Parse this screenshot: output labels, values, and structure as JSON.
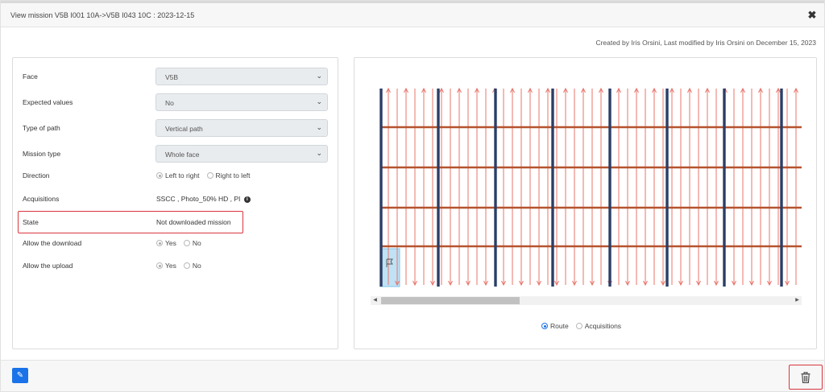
{
  "modal": {
    "title": "View mission V5B I001 10A->V5B I043 10C : 2023-12-15",
    "close_icon": "close-icon",
    "meta": "Created by Iris Orsini, Last modified by Iris Orsini on December 15, 2023"
  },
  "form": {
    "face": {
      "label": "Face",
      "value": "V5B"
    },
    "expected": {
      "label": "Expected values",
      "value": "No"
    },
    "path_type": {
      "label": "Type of path",
      "value": "Vertical path"
    },
    "mission_type": {
      "label": "Mission type",
      "value": "Whole face"
    },
    "direction": {
      "label": "Direction",
      "options": [
        "Left to right",
        "Right to left"
      ],
      "selected": "Left to right"
    },
    "acquisitions": {
      "label": "Acquisitions",
      "value": "SSCC , Photo_50% HD , PI",
      "info_icon": "info-icon"
    },
    "state": {
      "label": "State",
      "value": "Not downloaded mission"
    },
    "allow_download": {
      "label": "Allow the download",
      "options": [
        "Yes",
        "No"
      ],
      "selected": "Yes"
    },
    "allow_upload": {
      "label": "Allow the upload",
      "options": [
        "Yes",
        "No"
      ],
      "selected": "Yes"
    }
  },
  "map": {
    "view_options": [
      "Route",
      "Acquisitions"
    ],
    "selected_view": "Route",
    "colors": {
      "column": "#2c3e66",
      "beam": "#b5532e",
      "route": "#e8746a",
      "start_cell": "#bfe2f5"
    },
    "flag_icon": "flag-icon",
    "scroll_position": 0.0
  },
  "footer": {
    "edit_icon": "edit-icon",
    "delete_icon": "trash-icon",
    "accent": "#1a73e8",
    "danger": "#d9363e"
  }
}
